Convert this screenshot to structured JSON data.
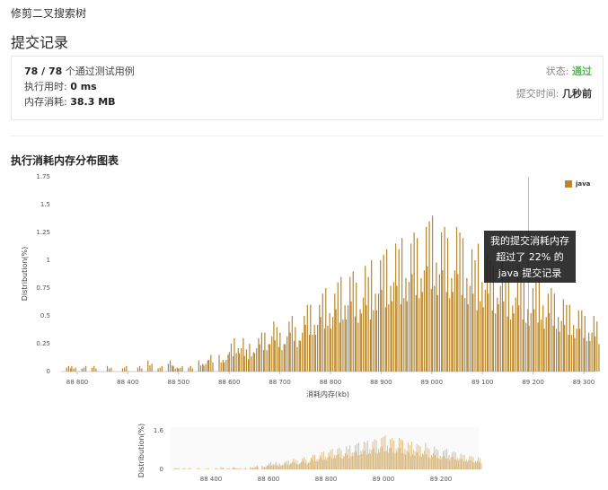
{
  "header": {
    "problem_title": "修剪二叉搜索树",
    "section_title": "提交记录"
  },
  "summary": {
    "passed": "78 / 78",
    "passed_suffix": "个通过测试用例",
    "runtime_label": "执行用时:",
    "runtime_value": "0 ms",
    "memory_label": "内存消耗:",
    "memory_value": "38.3 MB",
    "status_label": "状态:",
    "status_value": "通过",
    "time_label": "提交时间:",
    "time_value": "几秒前"
  },
  "colors": {
    "bar": "#b8862d",
    "bar_light": "#d9b880",
    "status": "#5cb85c"
  },
  "chart_title": "执行消耗内存分布图表",
  "tooltip": {
    "line1": "我的提交消耗内存",
    "line2": "超过了 22% 的",
    "line3": "java 提交记录"
  },
  "chart_data": [
    {
      "type": "bar",
      "legend": [
        "java"
      ],
      "legend_position": "top-right",
      "xlabel": "消耗内存(kb)",
      "ylabel": "Distribution(%)",
      "ylim": [
        0,
        1.75
      ],
      "yticks": [
        "0",
        "0.25",
        "0.5",
        "0.75",
        "1",
        "1.25",
        "1.5",
        "1.75"
      ],
      "xticks": [
        "88 800",
        "88 400",
        "88 500",
        "88 600",
        "88 700",
        "88 800",
        "88 900",
        "89 000",
        "89 100",
        "89 200",
        "89 300"
      ],
      "xrange": [
        88250,
        89300
      ],
      "marker_x": 89170,
      "grid": false,
      "series": [
        {
          "name": "java",
          "x": [
            88260,
            88270,
            88290,
            88310,
            88340,
            88370,
            88400,
            88420,
            88440,
            88460,
            88470,
            88480,
            88500,
            88520,
            88530,
            88540,
            88560,
            88570,
            88580,
            88590,
            88600,
            88610,
            88620,
            88630,
            88640,
            88650,
            88660,
            88670,
            88680,
            88690,
            88700,
            88710,
            88720,
            88730,
            88740,
            88750,
            88760,
            88770,
            88780,
            88790,
            88800,
            88810,
            88820,
            88830,
            88840,
            88850,
            88860,
            88870,
            88880,
            88890,
            88900,
            88910,
            88920,
            88930,
            88940,
            88950,
            88960,
            88970,
            88980,
            88990,
            89000,
            89010,
            89020,
            89030,
            89040,
            89050,
            89060,
            89070,
            89080,
            89090,
            89100,
            89110,
            89120,
            89130,
            89140,
            89150,
            89160,
            89170,
            89180,
            89190,
            89200,
            89210,
            89220,
            89230,
            89240,
            89250,
            89260,
            89270,
            89280,
            89290,
            89300
          ],
          "values": [
            0.05,
            0.05,
            0.05,
            0.05,
            0.05,
            0.05,
            0.05,
            0.1,
            0.05,
            0.1,
            0.05,
            0.05,
            0.05,
            0.1,
            0.1,
            0.15,
            0.15,
            0.15,
            0.25,
            0.3,
            0.3,
            0.2,
            0.25,
            0.3,
            0.35,
            0.35,
            0.45,
            0.4,
            0.35,
            0.45,
            0.5,
            0.4,
            0.5,
            0.6,
            0.6,
            0.6,
            0.7,
            0.75,
            0.7,
            0.8,
            0.85,
            0.85,
            0.9,
            0.8,
            0.95,
            0.85,
            1.0,
            1.0,
            1.05,
            1.1,
            1.15,
            1.1,
            1.2,
            1.15,
            1.25,
            1.2,
            1.3,
            1.35,
            1.4,
            1.25,
            1.3,
            1.2,
            1.3,
            1.25,
            1.2,
            1.1,
            1.0,
            1.15,
            1.05,
            1.0,
            0.95,
            1.1,
            0.9,
            0.85,
            0.95,
            0.85,
            0.8,
            0.75,
            0.8,
            0.85,
            0.7,
            0.75,
            0.7,
            0.65,
            0.6,
            0.6,
            0.55,
            0.55,
            0.5,
            0.5,
            0.45
          ]
        }
      ]
    },
    {
      "type": "bar",
      "role": "overview",
      "ylabel": "Distribution(%)",
      "ylim": [
        0,
        1.6
      ],
      "yticks": [
        "0",
        "1.6"
      ],
      "xticks": [
        "88 400",
        "88 600",
        "88 800",
        "89 000",
        "89 200"
      ],
      "xrange": [
        88250,
        89300
      ]
    }
  ]
}
